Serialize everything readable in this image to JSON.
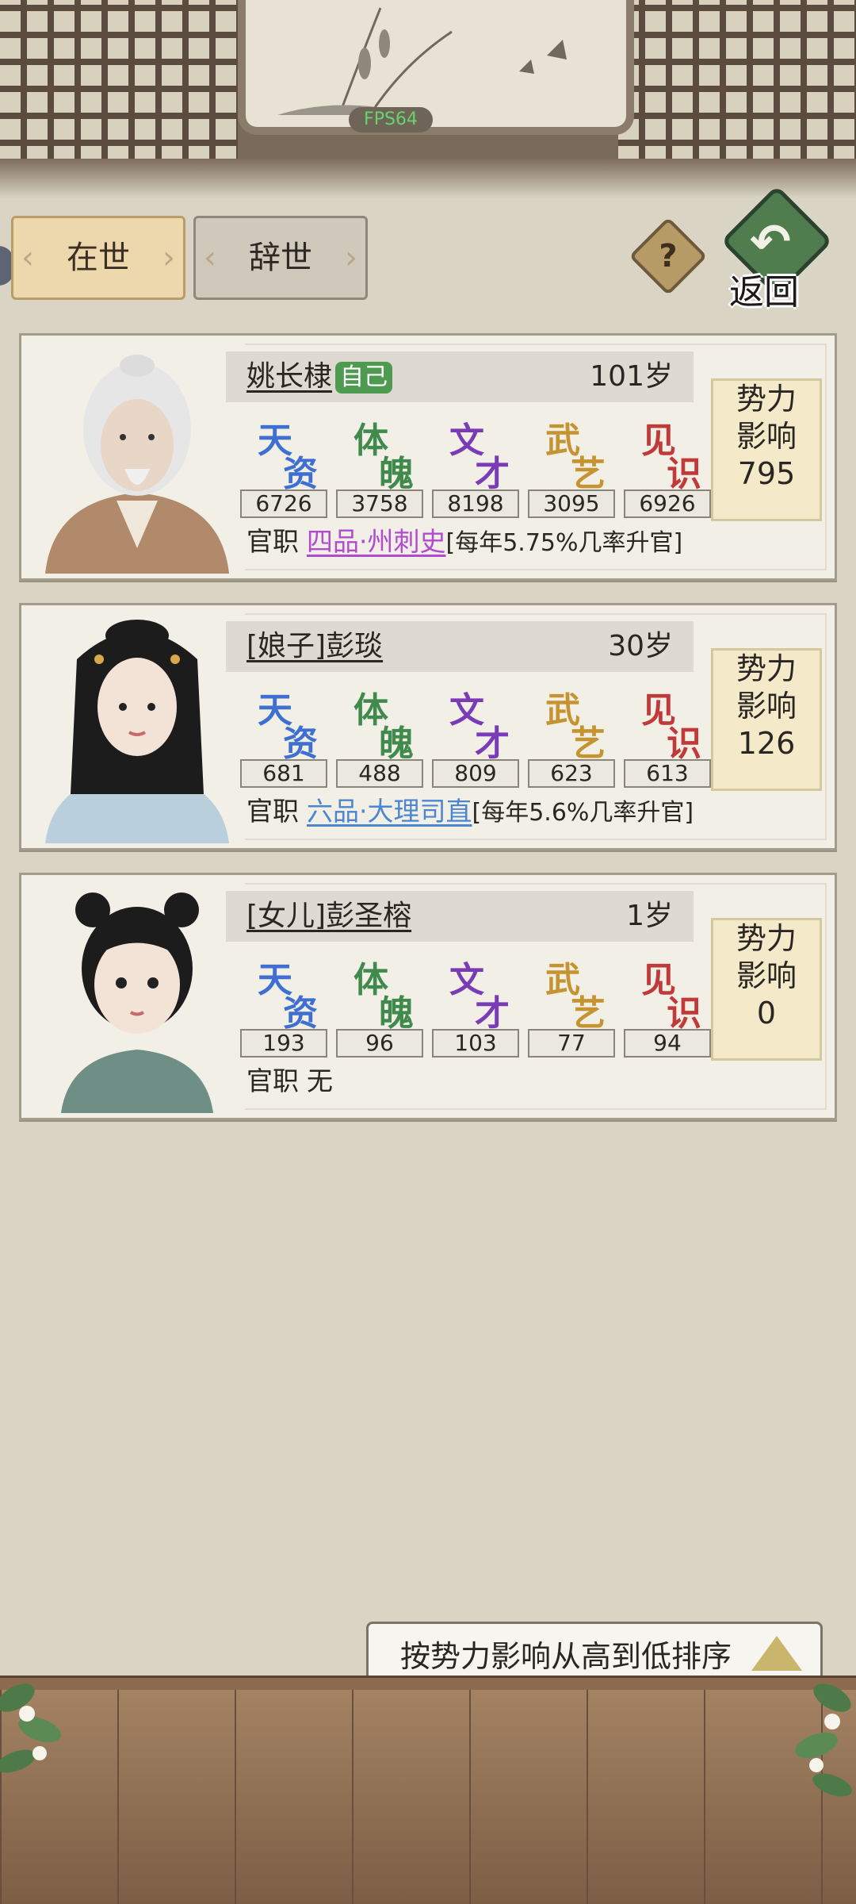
{
  "fps": "FPS64",
  "tabs": {
    "alive": "在世",
    "deceased": "辞世"
  },
  "help_label": "?",
  "back_label": "返回",
  "stat_names": [
    "天资",
    "体魄",
    "文才",
    "武艺",
    "见识"
  ],
  "stat_colors": [
    "#3f6fd0",
    "#3f8a4c",
    "#7a3cb6",
    "#c59431",
    "#c13a3a"
  ],
  "office_label": "官职",
  "power_label_1": "势力",
  "power_label_2": "影响",
  "members": [
    {
      "name": "姚长棣",
      "badge": "自己",
      "age": "101岁",
      "stats": [
        "6726",
        "3758",
        "8198",
        "3095",
        "6926"
      ],
      "office": "四品·州刺史",
      "office_color": "#b24bd1",
      "note": "[每年5.75%几率升官]",
      "power": "795"
    },
    {
      "name": "[娘子]彭琰",
      "age": "30岁",
      "stats": [
        "681",
        "488",
        "809",
        "623",
        "613"
      ],
      "office": "六品·大理司直",
      "office_color": "#4b86cf",
      "note": "[每年5.6%几率升官]",
      "power": "126"
    },
    {
      "name": "[女儿]彭圣榕",
      "age": "1岁",
      "stats": [
        "193",
        "96",
        "103",
        "77",
        "94"
      ],
      "office": "无",
      "power": "0"
    }
  ],
  "sort_label": "按势力影响从高到低排序"
}
